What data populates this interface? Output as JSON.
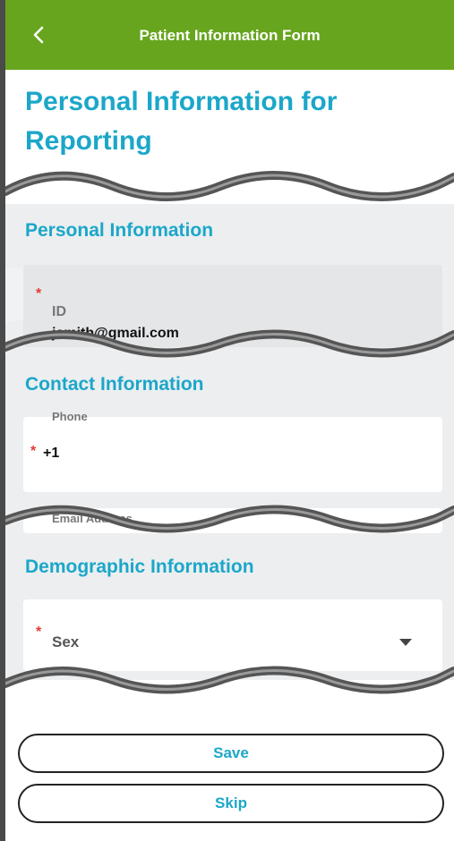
{
  "header": {
    "title": "Patient Information Form",
    "back_icon": "chevron-left-icon"
  },
  "page": {
    "title": "Personal Information for Reporting"
  },
  "sections": {
    "personal": {
      "title": "Personal Information",
      "id_field": {
        "label": "ID",
        "value": "jsmith@gmail.com",
        "required": true
      }
    },
    "contact": {
      "title": "Contact Information",
      "phone_field": {
        "label": "Phone",
        "value": "+1",
        "required": true
      },
      "email_field": {
        "label": "Email Address"
      }
    },
    "demographic": {
      "title": "Demographic Information",
      "sex_field": {
        "label": "Sex",
        "required": true,
        "icon": "dropdown-arrow-icon"
      }
    }
  },
  "actions": {
    "save_label": "Save",
    "skip_label": "Skip"
  },
  "colors": {
    "header": "#67a51e",
    "accent": "#1ba7c9",
    "required": "#e53935"
  }
}
